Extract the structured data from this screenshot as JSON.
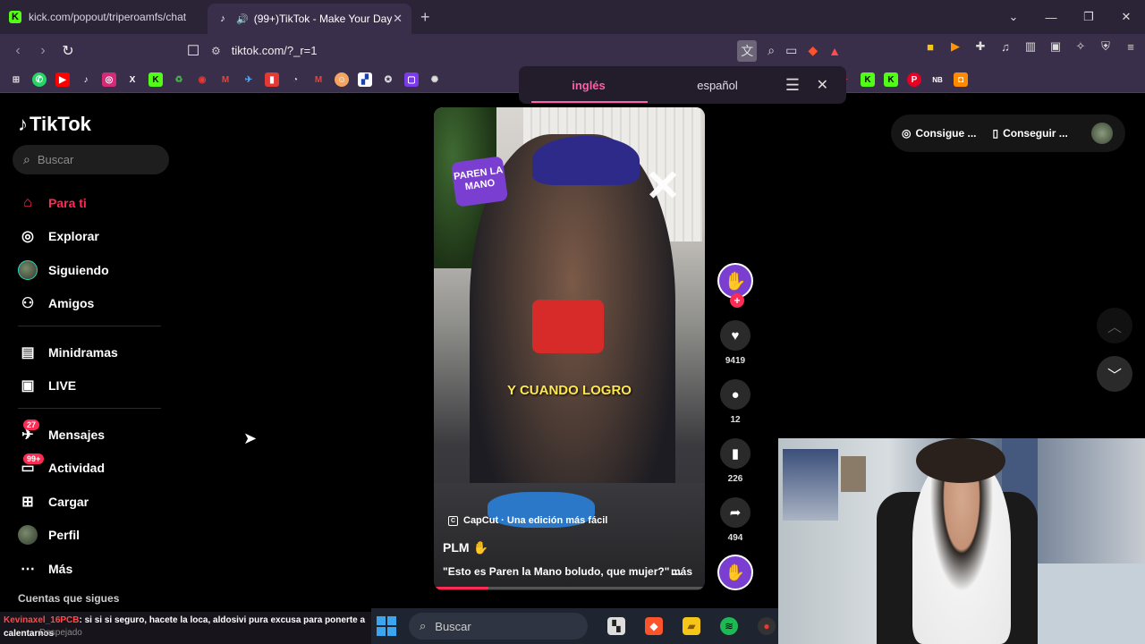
{
  "browser": {
    "tabs": [
      {
        "title": "kick.com/popout/triperoamfs/chat",
        "icon": "kick-icon"
      },
      {
        "title": "(99+)TikTok - Make Your Day",
        "icon": "tiktok-icon",
        "active": true
      }
    ],
    "new_tab": "+",
    "url": "tiktok.com/?_r=1",
    "window_controls": [
      "minimize",
      "maximize",
      "close"
    ],
    "brave_badge": "5"
  },
  "translate_popup": {
    "source_lang": "inglés",
    "target_lang": "español"
  },
  "tiktok": {
    "logo": "TikTok",
    "search_placeholder": "Buscar",
    "nav": [
      {
        "label": "Para ti",
        "icon": "home-icon",
        "active": true
      },
      {
        "label": "Explorar",
        "icon": "compass-icon"
      },
      {
        "label": "Siguiendo",
        "icon": "following-avatar-icon"
      },
      {
        "label": "Amigos",
        "icon": "friends-icon"
      },
      {
        "label": "Minidramas",
        "icon": "minidramas-icon"
      },
      {
        "label": "LIVE",
        "icon": "live-icon"
      },
      {
        "label": "Mensajes",
        "icon": "messages-icon",
        "badge": "27"
      },
      {
        "label": "Actividad",
        "icon": "activity-icon",
        "badge": "99+"
      },
      {
        "label": "Cargar",
        "icon": "upload-icon"
      },
      {
        "label": "Perfil",
        "icon": "profile-avatar-icon"
      },
      {
        "label": "Más",
        "icon": "more-icon"
      }
    ],
    "following_section_title": "Cuentas que sigues",
    "top_right": {
      "coins": "Consigue ...",
      "app": "Conseguir ..."
    },
    "video": {
      "brand_overlay": "PAREN LA MANO",
      "subtitle": "Y CUANDO LOGRO",
      "capcut": "CapCut · Una edición más fácil",
      "author": "PLM",
      "description": "\"Esto es Paren la Mano boludo, que mujer?\" ...",
      "more": "más",
      "progress": 0.2
    },
    "actions": {
      "likes": "9419",
      "comments": "12",
      "saves": "226",
      "shares": "494"
    }
  },
  "chat_overlay": {
    "username": "Kevinaxel_16PCB",
    "message": ": si si si seguro, hacete la loca, aldosivi pura excusa para ponerte a calentarnos",
    "under_text": "Despejado"
  },
  "taskbar": {
    "search_placeholder": "Buscar"
  },
  "colors": {
    "tiktok_red": "#fe2c55",
    "browser_bg": "#3a2f4a",
    "translate_accent": "#ff5fa8"
  }
}
